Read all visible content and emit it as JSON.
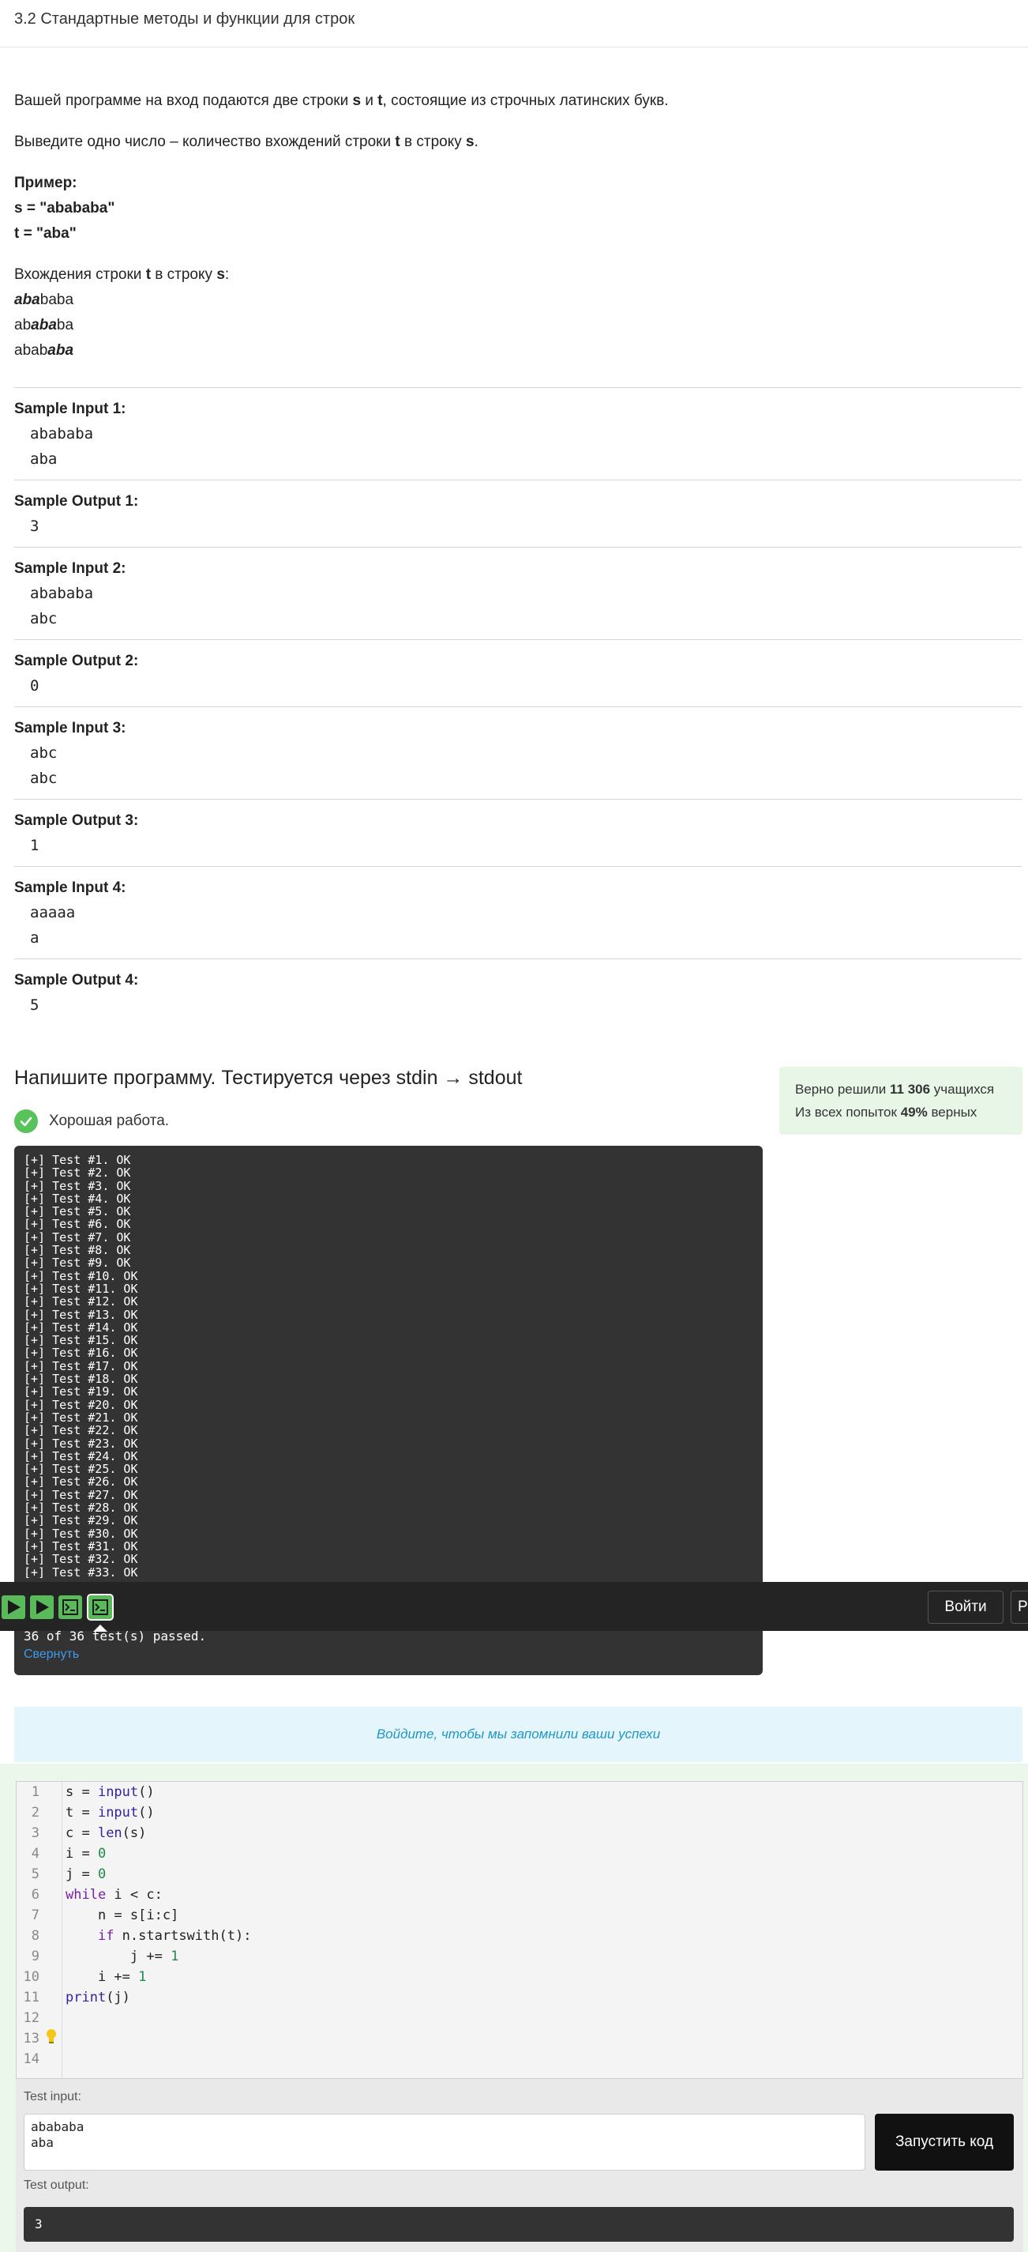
{
  "header": {
    "title": "3.2 Стандартные методы и функции для строк"
  },
  "problem": {
    "p1_pre": "Вашей программе на вход подаются две строки ",
    "p1_s": "s",
    "p1_and": " и ",
    "p1_t": "t",
    "p1_post": ", состоящие из строчных латинских букв.",
    "p2_pre": "Выведите одно число – количество вхождений строки ",
    "p2_t": "t",
    "p2_mid": " в строку ",
    "p2_s": "s",
    "p2_end": ".",
    "example_label": "Пример:",
    "example_s": "s = \"abababa\"",
    "example_t": "t = \"aba\"",
    "occ_pre": "Вхождения строки ",
    "occ_t": "t",
    "occ_mid": " в строку ",
    "occ_s": "s",
    "occ_end": ":",
    "occurrences": [
      {
        "pre": "",
        "hl": "aba",
        "post": "baba"
      },
      {
        "pre": "ab",
        "hl": "aba",
        "post": "ba"
      },
      {
        "pre": "abab",
        "hl": "aba",
        "post": ""
      }
    ]
  },
  "samples": [
    {
      "label": "Sample Input 1:",
      "lines": [
        "abababa",
        "aba"
      ]
    },
    {
      "label": "Sample Output 1:",
      "lines": [
        "3"
      ]
    },
    {
      "label": "Sample Input 2:",
      "lines": [
        "abababa",
        "abc"
      ]
    },
    {
      "label": "Sample Output 2:",
      "lines": [
        "0"
      ]
    },
    {
      "label": "Sample Input 3:",
      "lines": [
        "abc",
        "abc"
      ]
    },
    {
      "label": "Sample Output 3:",
      "lines": [
        "1"
      ]
    },
    {
      "label": "Sample Input 4:",
      "lines": [
        "aaaaa",
        "a"
      ]
    },
    {
      "label": "Sample Output 4:",
      "lines": [
        "5"
      ]
    }
  ],
  "task": {
    "title": "Напишите программу. Тестируется через stdin → stdout",
    "status": "Хорошая работа."
  },
  "stats": {
    "solved_pre": "Верно решили ",
    "solved_count": "11 306",
    "solved_post": " учащихся",
    "attempts_pre": "Из всех попыток ",
    "attempts_pct": "49%",
    "attempts_post": " верных"
  },
  "terminal": {
    "lines": [
      "[+] Test #1. OK",
      "[+] Test #2. OK",
      "[+] Test #3. OK",
      "[+] Test #4. OK",
      "[+] Test #5. OK",
      "[+] Test #6. OK",
      "[+] Test #7. OK",
      "[+] Test #8. OK",
      "[+] Test #9. OK",
      "[+] Test #10. OK",
      "[+] Test #11. OK",
      "[+] Test #12. OK",
      "[+] Test #13. OK",
      "[+] Test #14. OK",
      "[+] Test #15. OK",
      "[+] Test #16. OK",
      "[+] Test #17. OK",
      "[+] Test #18. OK",
      "[+] Test #19. OK",
      "[+] Test #20. OK",
      "[+] Test #21. OK",
      "[+] Test #22. OK",
      "[+] Test #23. OK",
      "[+] Test #24. OK",
      "[+] Test #25. OK",
      "[+] Test #26. OK",
      "[+] Test #27. OK",
      "[+] Test #28. OK",
      "[+] Test #29. OK",
      "[+] Test #30. OK",
      "[+] Test #31. OK",
      "[+] Test #32. OK",
      "[+] Test #33. OK"
    ],
    "summary": "36 of 36 test(s) passed.",
    "collapse": "Свернуть"
  },
  "toolbar": {
    "icons": [
      "play-icon",
      "play-icon",
      "terminal-icon",
      "terminal-icon"
    ],
    "login": "Войти",
    "edge_label": "Р"
  },
  "login_banner": "Войдите, чтобы мы запомнили ваши успехи",
  "editor": {
    "line_numbers": [
      "1",
      "2",
      "3",
      "4",
      "5",
      "6",
      "7",
      "8",
      "9",
      "10",
      "11",
      "12",
      "13",
      "14"
    ]
  },
  "test_panel": {
    "input_label": "Test input:",
    "input_value": "abababa\naba",
    "run_label": "Запустить код",
    "output_label": "Test output:",
    "output_value": "3"
  },
  "colors": {
    "success": "#58c25b",
    "link": "#3d9be9",
    "terminal_bg": "#333333",
    "stats_bg": "#e8f6e8",
    "banner_bg": "#e4f5fc"
  }
}
